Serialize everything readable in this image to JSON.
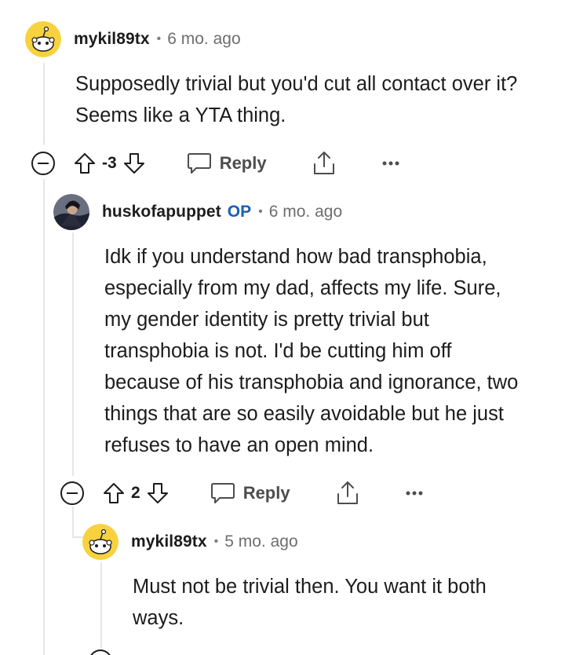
{
  "comments": [
    {
      "username": "mykil89tx",
      "separator": "•",
      "age": "6 mo. ago",
      "body": "Supposedly trivial but you'd cut all contact over it? Seems like a YTA thing.",
      "score": "-3",
      "reply_label": "Reply",
      "avatar_icon": "snoo-avatar-icon"
    },
    {
      "username": "huskofapuppet",
      "op_badge": "OP",
      "separator": "•",
      "age": "6 mo. ago",
      "body": "Idk if you understand how bad transphobia, especially from my dad, affects my life. Sure, my gender identity is pretty trivial but transphobia is not. I'd be cutting him off because of his transphobia and ignorance, two things that are so easily avoidable but he just refuses to have an open mind.",
      "score": "2",
      "reply_label": "Reply",
      "avatar_icon": "user-photo-avatar"
    },
    {
      "username": "mykil89tx",
      "separator": "•",
      "age": "5 mo. ago",
      "body": "Must not be trivial then. You want it both ways.",
      "avatar_icon": "snoo-avatar-icon"
    }
  ],
  "colors": {
    "text": "#1c1c1c",
    "muted": "#6e6e6e",
    "op": "#1a5fb4",
    "avatar_bg": "#f7d23e",
    "thread_line": "#e4e6e8"
  }
}
